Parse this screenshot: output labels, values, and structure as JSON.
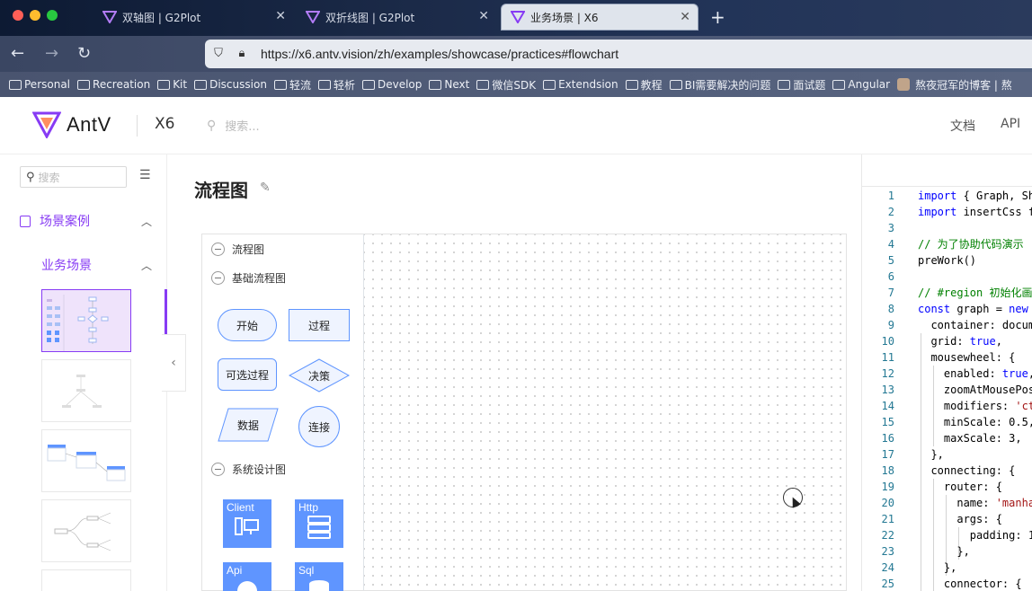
{
  "browser": {
    "tabs": [
      {
        "label": "双轴图 | G2Plot",
        "active": false
      },
      {
        "label": "双折线图 | G2Plot",
        "active": false
      },
      {
        "label": "业务场景 | X6",
        "active": true
      }
    ],
    "url": "https://x6.antv.vision/zh/examples/showcase/practices#flowchart",
    "bookmarks": [
      "Personal",
      "Recreation",
      "Kit",
      "Discussion",
      "轻流",
      "轻析",
      "Develop",
      "Next",
      "微信SDK",
      "Extendsion",
      "教程",
      "BI需要解决的问题",
      "面试题",
      "Angular",
      "熬夜冠军的博客 | 熬"
    ],
    "icons": {
      "back": "arrow-left-icon",
      "forward": "arrow-right-icon",
      "reload": "reload-icon",
      "shield": "shield-icon",
      "lock": "lock-icon",
      "new_tab": "plus-icon"
    }
  },
  "header": {
    "brand": "AntV",
    "product": "X6",
    "search_placeholder": "搜索...",
    "nav": [
      "文档",
      "API"
    ],
    "accent": "#873bf4"
  },
  "sidebar": {
    "search_placeholder": "搜索",
    "category": "场景案例",
    "subcategory": "业务场景",
    "collapse_icon": "chevron-left-icon"
  },
  "main": {
    "title": "流程图",
    "stencil": {
      "root_group": "流程图",
      "group_basic": "基础流程图",
      "basic_nodes": [
        "开始",
        "过程",
        "可选过程",
        "决策",
        "数据",
        "连接"
      ],
      "group_system": "系统设计图",
      "system_nodes": [
        "Client",
        "Http",
        "Api",
        "Sql"
      ],
      "node_fill": "#eff4ff",
      "node_stroke": "#5f95ff",
      "system_fill": "#5f95ff"
    }
  },
  "code": {
    "lines": [
      {
        "n": "1",
        "t": "import { Graph, Sh"
      },
      {
        "n": "2",
        "t": "import insertCss f"
      },
      {
        "n": "3",
        "t": ""
      },
      {
        "n": "4",
        "t": "// 为了协助代码演示"
      },
      {
        "n": "5",
        "t": "preWork()"
      },
      {
        "n": "6",
        "t": ""
      },
      {
        "n": "7",
        "t": "// #region 初始化画"
      },
      {
        "n": "8",
        "t": "const graph = new "
      },
      {
        "n": "9",
        "t": "  container: docum"
      },
      {
        "n": "10",
        "t": "  grid: true,"
      },
      {
        "n": "11",
        "t": "  mousewheel: {"
      },
      {
        "n": "12",
        "t": "    enabled: true,"
      },
      {
        "n": "13",
        "t": "    zoomAtMousePos"
      },
      {
        "n": "14",
        "t": "    modifiers: 'ct"
      },
      {
        "n": "15",
        "t": "    minScale: 0.5,"
      },
      {
        "n": "16",
        "t": "    maxScale: 3,"
      },
      {
        "n": "17",
        "t": "  },"
      },
      {
        "n": "18",
        "t": "  connecting: {"
      },
      {
        "n": "19",
        "t": "    router: {"
      },
      {
        "n": "20",
        "t": "      name: 'manha"
      },
      {
        "n": "21",
        "t": "      args: {"
      },
      {
        "n": "22",
        "t": "        padding: 1"
      },
      {
        "n": "23",
        "t": "      },"
      },
      {
        "n": "24",
        "t": "    },"
      },
      {
        "n": "25",
        "t": "    connector: {"
      }
    ]
  }
}
